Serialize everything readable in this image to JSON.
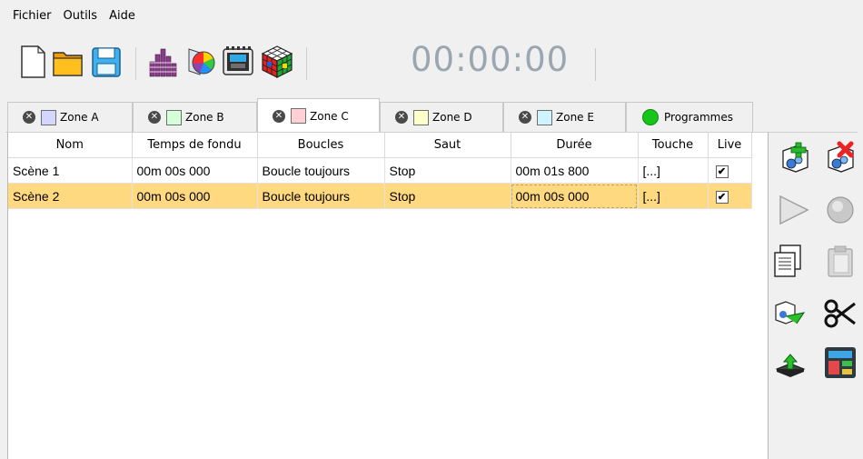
{
  "menu": {
    "fichier": "Fichier",
    "outils": "Outils",
    "aide": "Aide"
  },
  "timer": "00:00:00",
  "tabs": [
    {
      "label": "Zone A",
      "color": "#d4d6ff"
    },
    {
      "label": "Zone B",
      "color": "#d5ffd9"
    },
    {
      "label": "Zone C",
      "color": "#ffd0d4"
    },
    {
      "label": "Zone D",
      "color": "#ffffc9"
    },
    {
      "label": "Zone E",
      "color": "#cdf4ff"
    },
    {
      "label": "Programmes",
      "color": "#17c417"
    }
  ],
  "table": {
    "headers": [
      "Nom",
      "Temps de fondu",
      "Boucles",
      "Saut",
      "Durée",
      "Touche",
      "Live"
    ],
    "rows": [
      {
        "nom": "Scène 1",
        "fondu": "00m 00s 000",
        "boucles": "Boucle toujours",
        "saut": "Stop",
        "duree": "00m 01s 800",
        "touche": "[...]",
        "live": "✔"
      },
      {
        "nom": "Scène 2",
        "fondu": "00m 00s 000",
        "boucles": "Boucle toujours",
        "saut": "Stop",
        "duree": "00m 00s 000",
        "touche": "[...]",
        "live": "✔"
      }
    ]
  },
  "toolbar_icons": [
    "new-file-icon",
    "open-folder-icon",
    "save-icon",
    "equalizer-icon",
    "color-wheel-icon",
    "device-icon",
    "rubik-cube-icon"
  ],
  "side_icons": [
    "add-scene-icon",
    "remove-scene-icon",
    "play-icon",
    "record-icon",
    "copy-icon",
    "paste-icon",
    "link-icon",
    "cut-icon",
    "upload-chip-icon",
    "layout-icon"
  ]
}
